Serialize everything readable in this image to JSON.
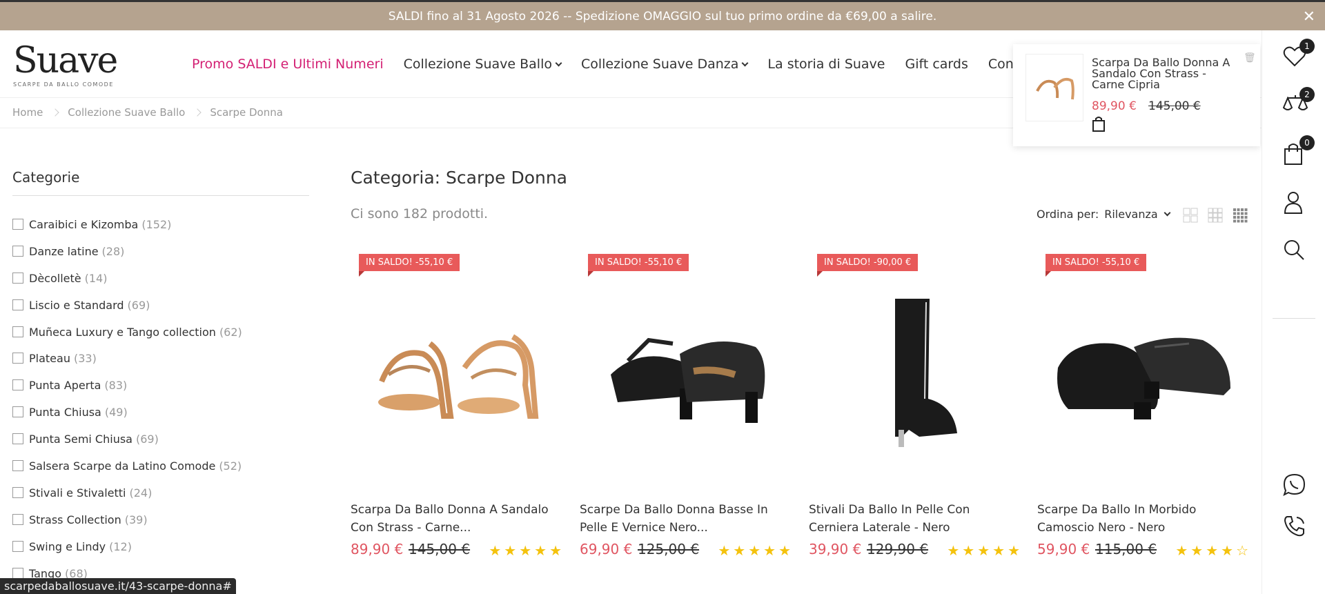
{
  "promo": {
    "text_pre": "SALDI fino al 31 Agosto 2026 -- ",
    "text_bold": "Spedizione OMAGGIO",
    "text_post": " sul tuo primo ordine da €69,00 a salire.",
    "close": "✕"
  },
  "logo": {
    "main": "Suave",
    "sub": "SCARPE DA BALLO COMODE"
  },
  "nav": [
    {
      "label": "Promo SALDI e Ultimi Numeri"
    },
    {
      "label": "Collezione Suave Ballo"
    },
    {
      "label": "Collezione Suave Danza"
    },
    {
      "label": "La storia di Suave"
    },
    {
      "label": "Gift cards"
    },
    {
      "label": "Contattaci"
    }
  ],
  "breadcrumb": [
    "Home",
    "Collezione Suave Ballo",
    "Scarpe Donna"
  ],
  "rail": {
    "wishlist_count": "1",
    "compare_count": "2",
    "cart_count": "0"
  },
  "mini_popup": {
    "title": "Scarpa Da Ballo Donna A Sandalo Con Strass - Carne Cipria",
    "price": "89,90 €",
    "old_price": "145,00 €"
  },
  "filters": {
    "title": "Categorie",
    "items": [
      {
        "label": "Caraibici e Kizomba",
        "count": "(152)"
      },
      {
        "label": "Danze latine",
        "count": "(28)"
      },
      {
        "label": "Dècolletè",
        "count": "(14)"
      },
      {
        "label": "Liscio e Standard",
        "count": "(69)"
      },
      {
        "label": "Muñeca Luxury e Tango collection",
        "count": "(62)"
      },
      {
        "label": "Plateau",
        "count": "(33)"
      },
      {
        "label": "Punta Aperta",
        "count": "(83)"
      },
      {
        "label": "Punta Chiusa",
        "count": "(49)"
      },
      {
        "label": "Punta Semi Chiusa",
        "count": "(69)"
      },
      {
        "label": "Salsera Scarpe da Latino Comode",
        "count": "(52)"
      },
      {
        "label": "Stivali e Stivaletti",
        "count": "(24)"
      },
      {
        "label": "Strass Collection",
        "count": "(39)"
      },
      {
        "label": "Swing e Lindy",
        "count": "(12)"
      },
      {
        "label": "Tango",
        "count": "(68)"
      }
    ]
  },
  "main": {
    "title": "Categoria: Scarpe Donna",
    "count_text": "Ci sono 182 prodotti.",
    "sort_label": "Ordina per:",
    "sort_value": "Rilevanza"
  },
  "products": [
    {
      "badge": "IN SALDO! -55,10 €",
      "name": "Scarpa Da Ballo Donna A Sandalo Con Strass - Carne...",
      "price": "89,90 €",
      "old_price": "145,00 €",
      "stars": "★★★★★",
      "rating": 5
    },
    {
      "badge": "IN SALDO! -55,10 €",
      "name": "Scarpe Da Ballo Donna Basse In Pelle E Vernice Nero...",
      "price": "69,90 €",
      "old_price": "125,00 €",
      "stars": "★★★★★",
      "rating": 5
    },
    {
      "badge": "IN SALDO! -90,00 €",
      "name": "Stivali Da Ballo In Pelle Con Cerniera Laterale - Nero",
      "price": "39,90 €",
      "old_price": "129,90 €",
      "stars": "★★★★★",
      "rating": 5
    },
    {
      "badge": "IN SALDO! -55,10 €",
      "name": "Scarpe Da Ballo In Morbido Camoscio Nero - Nero",
      "price": "59,90 €",
      "old_price": "115,00 €",
      "stars": "★★★★☆",
      "rating": 4
    }
  ],
  "status_url": "scarpedaballosuave.it/43-scarpe-donna#",
  "colors": {
    "promo_bg": "#b5a38f",
    "accent": "#d31f73",
    "sale": "#e05561",
    "badge": "#e85a5a",
    "star": "#f4c20d"
  }
}
